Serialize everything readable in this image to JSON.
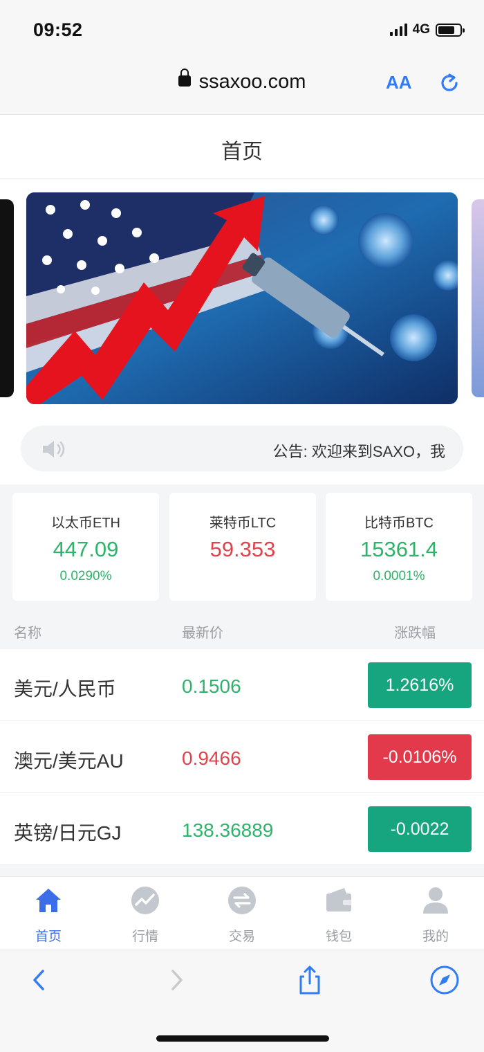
{
  "status_bar": {
    "time": "09:52",
    "network": "4G",
    "battery_level": 0.75
  },
  "browser": {
    "url": "ssaxoo.com",
    "text_size_label": "AA"
  },
  "header": {
    "title": "首页"
  },
  "notice": {
    "text": "公告: 欢迎来到SAXO，我"
  },
  "tickers": [
    {
      "name": "以太币ETH",
      "price": "447.09",
      "change": "0.0290%",
      "trend": "up"
    },
    {
      "name": "莱特币LTC",
      "price": "59.353",
      "change": "",
      "trend": "down"
    },
    {
      "name": "比特币BTC",
      "price": "15361.4",
      "change": "0.0001%",
      "trend": "up"
    }
  ],
  "table": {
    "headers": {
      "name": "名称",
      "price": "最新价",
      "change": "涨跌幅"
    },
    "rows": [
      {
        "name": "美元/人民币",
        "price": "0.1506",
        "change": "1.2616%",
        "trend": "up"
      },
      {
        "name": "澳元/美元AU",
        "price": "0.9466",
        "change": "-0.0106%",
        "trend": "down"
      },
      {
        "name": "英镑/日元GJ",
        "price": "138.36889",
        "change": "-0.0022",
        "trend": "up"
      }
    ]
  },
  "tabbar": [
    {
      "label": "首页",
      "icon": "home-icon",
      "active": true
    },
    {
      "label": "行情",
      "icon": "market-trend-icon",
      "active": false
    },
    {
      "label": "交易",
      "icon": "exchange-icon",
      "active": false
    },
    {
      "label": "钱包",
      "icon": "wallet-icon",
      "active": false
    },
    {
      "label": "我的",
      "icon": "user-icon",
      "active": false
    }
  ],
  "colors": {
    "up": "#2eb36a",
    "down": "#e0434b",
    "badge_up": "#16a57f",
    "badge_down": "#e23a4a",
    "accent": "#3b6ee8",
    "browser_accent": "#2f7cf6"
  }
}
